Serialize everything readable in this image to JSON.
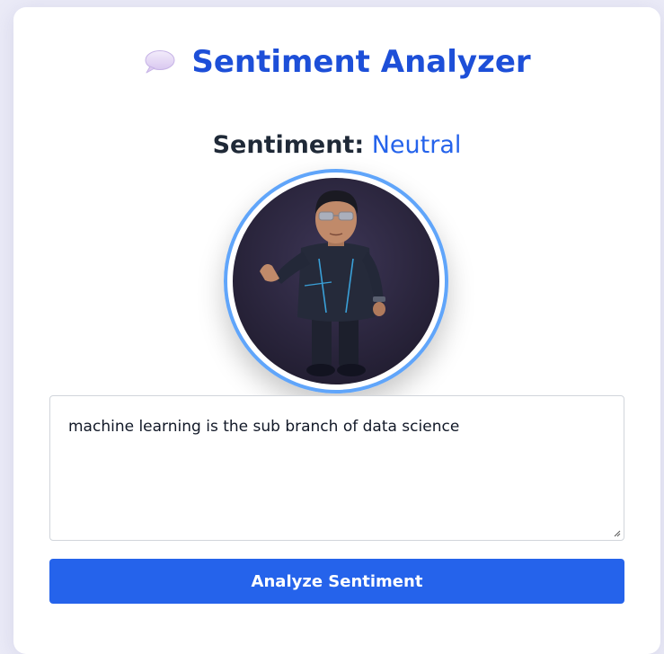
{
  "header": {
    "icon": "speech-bubble-icon",
    "title": "Sentiment Analyzer"
  },
  "result": {
    "label": "Sentiment:",
    "value": "Neutral"
  },
  "avatar": {
    "icon": "character-avatar"
  },
  "input": {
    "value": "machine learning is the sub branch of data science"
  },
  "actions": {
    "analyze_label": "Analyze Sentiment"
  },
  "colors": {
    "title": "#1d4fd8",
    "accent": "#2563eb",
    "avatar_ring": "#60a5fa",
    "background": "#ebebf7"
  }
}
